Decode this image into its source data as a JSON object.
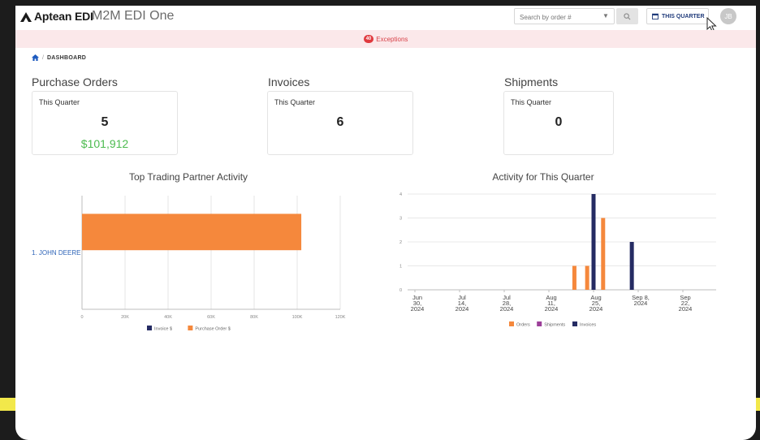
{
  "app": {
    "brand": "Aptean EDI",
    "name": "M2M EDI One"
  },
  "header": {
    "search_placeholder": "Search by order #",
    "period_button": "THIS QUARTER",
    "user_initials": "JB"
  },
  "exceptions": {
    "count": "40",
    "label": "Exceptions"
  },
  "breadcrumb": {
    "current": "DASHBOARD",
    "separator": "/"
  },
  "sections": [
    {
      "title": "Purchase Orders",
      "caption": "This Quarter",
      "count": "5",
      "amount": "$101,912"
    },
    {
      "title": "Invoices",
      "caption": "This Quarter",
      "count": "6"
    },
    {
      "title": "Shipments",
      "caption": "This Quarter",
      "count": "0"
    }
  ],
  "colors": {
    "orders": "#f5883c",
    "shipments": "#9c3f99",
    "invoices": "#252b63",
    "money": "#4cbb4f",
    "exception": "#e0393e"
  },
  "chart_data": [
    {
      "type": "bar",
      "orientation": "horizontal",
      "title": "Top Trading Partner Activity",
      "categories": [
        "1. JOHN DEERE"
      ],
      "series": [
        {
          "name": "Invoice $",
          "values": [
            0
          ]
        },
        {
          "name": "Purchase Order $",
          "values": [
            101912
          ]
        }
      ],
      "xlim": [
        0,
        120000
      ],
      "xticks": [
        0,
        20000,
        40000,
        60000,
        80000,
        100000,
        120000
      ],
      "xtick_labels": [
        "0",
        "20K",
        "40K",
        "60K",
        "80K",
        "100K",
        "120K"
      ],
      "legend": "bottom",
      "grid": true
    },
    {
      "type": "bar",
      "title": "Activity for This Quarter",
      "x_ticks": [
        [
          "Jun",
          "30,",
          "2024"
        ],
        [
          "Jul",
          "14,",
          "2024"
        ],
        [
          "Jul",
          "28,",
          "2024"
        ],
        [
          "Aug",
          "11,",
          "2024"
        ],
        [
          "Aug",
          "25,",
          "2024"
        ],
        [
          "Sep 8,",
          "2024"
        ],
        [
          "Sep",
          "22,",
          "2024"
        ]
      ],
      "x_tick_dates": [
        "2024-06-30",
        "2024-07-14",
        "2024-07-28",
        "2024-08-11",
        "2024-08-25",
        "2024-09-08",
        "2024-09-22"
      ],
      "ylim": [
        0,
        4
      ],
      "yticks": [
        0,
        1,
        2,
        3,
        4
      ],
      "series": [
        {
          "name": "Orders",
          "points": [
            {
              "x": "2024-08-19",
              "y": 1
            },
            {
              "x": "2024-08-23",
              "y": 1
            },
            {
              "x": "2024-08-28",
              "y": 3
            }
          ]
        },
        {
          "name": "Shipments",
          "points": []
        },
        {
          "name": "Invoices",
          "points": [
            {
              "x": "2024-08-25",
              "y": 4
            },
            {
              "x": "2024-09-06",
              "y": 2
            }
          ]
        }
      ],
      "legend": "bottom",
      "grid": true
    }
  ]
}
